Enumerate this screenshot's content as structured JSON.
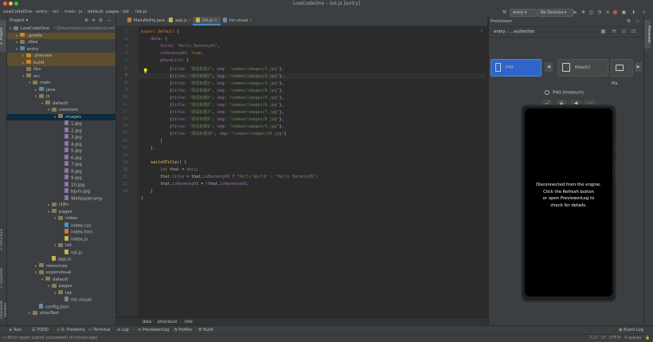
{
  "window": {
    "title": "LowCodeOne – list.js [entry]"
  },
  "nav": {
    "breadcrumb": [
      "LowCodeOne",
      "entry",
      "src",
      "main",
      "js",
      "default",
      "pages",
      "list",
      "list.js"
    ],
    "run_config": "entry",
    "device": "No Devices"
  },
  "project": {
    "header": "Project",
    "rows": [
      {
        "indent": 0,
        "arrow": "▾",
        "icon": "folder-blue",
        "label": "LowCodeOne",
        "hint": "~/Downloads/codelabs/LowC",
        "state": ""
      },
      {
        "indent": 1,
        "arrow": "▸",
        "icon": "folder-orange",
        "label": ".gradle",
        "hint": "",
        "state": "hl"
      },
      {
        "indent": 1,
        "arrow": "▸",
        "icon": "folder",
        "label": ".idea",
        "hint": "",
        "state": ""
      },
      {
        "indent": 1,
        "arrow": "▾",
        "icon": "folder-blue",
        "label": "entry",
        "hint": "",
        "state": ""
      },
      {
        "indent": 2,
        "arrow": "▸",
        "icon": "folder-orange",
        "label": ".preview",
        "hint": "",
        "state": "hl"
      },
      {
        "indent": 2,
        "arrow": "▸",
        "icon": "folder-orange",
        "label": "build",
        "hint": "",
        "state": "hl"
      },
      {
        "indent": 2,
        "arrow": "",
        "icon": "folder",
        "label": "libs",
        "hint": "",
        "state": ""
      },
      {
        "indent": 2,
        "arrow": "▾",
        "icon": "folder",
        "label": "src",
        "hint": "",
        "state": ""
      },
      {
        "indent": 3,
        "arrow": "▾",
        "icon": "folder",
        "label": "main",
        "hint": "",
        "state": ""
      },
      {
        "indent": 4,
        "arrow": "▸",
        "icon": "folder-blue",
        "label": "java",
        "hint": "",
        "state": ""
      },
      {
        "indent": 4,
        "arrow": "▾",
        "icon": "folder",
        "label": "js",
        "hint": "",
        "state": ""
      },
      {
        "indent": 5,
        "arrow": "▾",
        "icon": "folder",
        "label": "default",
        "hint": "",
        "state": ""
      },
      {
        "indent": 6,
        "arrow": "▾",
        "icon": "folder",
        "label": "common",
        "hint": "",
        "state": ""
      },
      {
        "indent": 7,
        "arrow": "▾",
        "icon": "folder",
        "label": "images",
        "hint": "",
        "state": "sel"
      },
      {
        "indent": 8,
        "arrow": "",
        "icon": "file-img",
        "label": "1.jpg",
        "hint": "",
        "state": ""
      },
      {
        "indent": 8,
        "arrow": "",
        "icon": "file-img",
        "label": "2.jpg",
        "hint": "",
        "state": ""
      },
      {
        "indent": 8,
        "arrow": "",
        "icon": "file-img",
        "label": "3.jpg",
        "hint": "",
        "state": ""
      },
      {
        "indent": 8,
        "arrow": "",
        "icon": "file-img",
        "label": "4.jpg",
        "hint": "",
        "state": ""
      },
      {
        "indent": 8,
        "arrow": "",
        "icon": "file-img",
        "label": "5.jpg",
        "hint": "",
        "state": ""
      },
      {
        "indent": 8,
        "arrow": "",
        "icon": "file-img",
        "label": "6.jpg",
        "hint": "",
        "state": ""
      },
      {
        "indent": 8,
        "arrow": "",
        "icon": "file-img",
        "label": "7.jpg",
        "hint": "",
        "state": ""
      },
      {
        "indent": 8,
        "arrow": "",
        "icon": "file-img",
        "label": "8.jpg",
        "hint": "",
        "state": ""
      },
      {
        "indent": 8,
        "arrow": "",
        "icon": "file-img",
        "label": "9.jpg",
        "hint": "",
        "state": ""
      },
      {
        "indent": 8,
        "arrow": "",
        "icon": "file-img",
        "label": "10.jpg",
        "hint": "",
        "state": ""
      },
      {
        "indent": 8,
        "arrow": "",
        "icon": "file-img",
        "label": "bg-tv.jpg",
        "hint": "",
        "state": ""
      },
      {
        "indent": 8,
        "arrow": "",
        "icon": "file-img",
        "label": "Wallpaper.png",
        "hint": "",
        "state": ""
      },
      {
        "indent": 6,
        "arrow": "▸",
        "icon": "folder",
        "label": "i18n",
        "hint": "",
        "state": ""
      },
      {
        "indent": 6,
        "arrow": "▾",
        "icon": "folder",
        "label": "pages",
        "hint": "",
        "state": ""
      },
      {
        "indent": 7,
        "arrow": "▾",
        "icon": "folder",
        "label": "index",
        "hint": "",
        "state": ""
      },
      {
        "indent": 8,
        "arrow": "",
        "icon": "file-css",
        "label": "index.css",
        "hint": "",
        "state": ""
      },
      {
        "indent": 8,
        "arrow": "",
        "icon": "file-html",
        "label": "index.hml",
        "hint": "",
        "state": ""
      },
      {
        "indent": 8,
        "arrow": "",
        "icon": "file-js",
        "label": "index.js",
        "hint": "",
        "state": ""
      },
      {
        "indent": 7,
        "arrow": "▾",
        "icon": "folder",
        "label": "list",
        "hint": "",
        "state": ""
      },
      {
        "indent": 8,
        "arrow": "",
        "icon": "file-js",
        "label": "list.js",
        "hint": "",
        "state": ""
      },
      {
        "indent": 6,
        "arrow": "",
        "icon": "file-js",
        "label": "app.js",
        "hint": "",
        "state": ""
      },
      {
        "indent": 4,
        "arrow": "▸",
        "icon": "folder",
        "label": "resources",
        "hint": "",
        "state": ""
      },
      {
        "indent": 4,
        "arrow": "▾",
        "icon": "folder",
        "label": "supervisual",
        "hint": "",
        "state": ""
      },
      {
        "indent": 5,
        "arrow": "▾",
        "icon": "folder",
        "label": "default",
        "hint": "",
        "state": ""
      },
      {
        "indent": 6,
        "arrow": "▾",
        "icon": "folder",
        "label": "pages",
        "hint": "",
        "state": ""
      },
      {
        "indent": 7,
        "arrow": "▾",
        "icon": "folder",
        "label": "list",
        "hint": "",
        "state": ""
      },
      {
        "indent": 8,
        "arrow": "",
        "icon": "file",
        "label": "list.visual",
        "hint": "",
        "state": ""
      },
      {
        "indent": 4,
        "arrow": "",
        "icon": "file",
        "label": "config.json",
        "hint": "",
        "state": ""
      },
      {
        "indent": 3,
        "arrow": "▸",
        "icon": "folder",
        "label": "ohosTest",
        "hint": "",
        "state": ""
      }
    ]
  },
  "editor": {
    "tabs": [
      "MainAbility.java",
      "app.js",
      "list.js",
      "list.visual"
    ],
    "active_tab": 2,
    "line_numbers": [
      "1",
      "2",
      "3",
      "4",
      "5",
      "6",
      "7",
      "8",
      "9",
      "10",
      "11",
      "12",
      "13",
      "14",
      "15",
      "16",
      "17",
      "18",
      "19",
      "20",
      "21",
      "22",
      "23"
    ],
    "code": [
      [
        [
          "kw",
          "export default "
        ],
        [
          "",
          "{"
        ]
      ],
      [
        [
          "",
          "    "
        ],
        [
          "prop",
          "data"
        ],
        [
          "",
          ": {"
        ]
      ],
      [
        [
          "",
          "        "
        ],
        [
          "prop",
          "title"
        ],
        [
          "",
          ": "
        ],
        [
          "str",
          "\"Hello HarmonyOS\""
        ],
        [
          "",
          ","
        ]
      ],
      [
        [
          "",
          "        "
        ],
        [
          "prop",
          "isHarmonyOS"
        ],
        [
          "",
          ": "
        ],
        [
          "kw",
          "true"
        ],
        [
          "",
          ","
        ]
      ],
      [
        [
          "",
          "        "
        ],
        [
          "prop",
          "phoneList"
        ],
        [
          "",
          ": ["
        ]
      ],
      [
        [
          "",
          "            {"
        ],
        [
          "prop",
          "title"
        ],
        [
          "",
          ": "
        ],
        [
          "str",
          "\"测试标题1\""
        ],
        [
          "",
          ", "
        ],
        [
          "prop",
          "img"
        ],
        [
          "",
          ": "
        ],
        [
          "str",
          "\"common/images/1.jpg\""
        ],
        [
          "",
          "},"
        ]
      ],
      [
        [
          "",
          "            {"
        ],
        [
          "prop",
          "title"
        ],
        [
          "",
          ": "
        ],
        [
          "str",
          "\"测试标题2\""
        ],
        [
          "",
          ", "
        ],
        [
          "prop",
          "img"
        ],
        [
          "",
          ": "
        ],
        [
          "str",
          "\"common/images/2.jpg\""
        ],
        [
          "",
          "},"
        ]
      ],
      [
        [
          "",
          "            {"
        ],
        [
          "prop",
          "title"
        ],
        [
          "",
          ": "
        ],
        [
          "str",
          "\"测试标题3\""
        ],
        [
          "",
          ", "
        ],
        [
          "prop",
          "img"
        ],
        [
          "",
          ": "
        ],
        [
          "str",
          "\"common/images/3.jpg\""
        ],
        [
          "",
          "},"
        ]
      ],
      [
        [
          "",
          "            {"
        ],
        [
          "prop",
          "title"
        ],
        [
          "",
          ": "
        ],
        [
          "str",
          "\"测试标题4\""
        ],
        [
          "",
          ", "
        ],
        [
          "prop",
          "img"
        ],
        [
          "",
          ": "
        ],
        [
          "str",
          "\"common/images/4.jpg\""
        ],
        [
          "",
          "},"
        ]
      ],
      [
        [
          "",
          "            {"
        ],
        [
          "prop",
          "title"
        ],
        [
          "",
          ": "
        ],
        [
          "str",
          "\"测试标题5\""
        ],
        [
          "",
          ", "
        ],
        [
          "prop",
          "img"
        ],
        [
          "",
          ": "
        ],
        [
          "str",
          "\"common/images/5.jpg\""
        ],
        [
          "",
          "},"
        ]
      ],
      [
        [
          "",
          "            {"
        ],
        [
          "prop",
          "title"
        ],
        [
          "",
          ": "
        ],
        [
          "str",
          "\"测试标题6\""
        ],
        [
          "",
          ", "
        ],
        [
          "prop",
          "img"
        ],
        [
          "",
          ": "
        ],
        [
          "str",
          "\"common/images/6.jpg\""
        ],
        [
          "",
          "},"
        ]
      ],
      [
        [
          "",
          "            {"
        ],
        [
          "prop",
          "title"
        ],
        [
          "",
          ": "
        ],
        [
          "str",
          "\"测试标题7\""
        ],
        [
          "",
          ", "
        ],
        [
          "prop",
          "img"
        ],
        [
          "",
          ": "
        ],
        [
          "str",
          "\"common/images/7.jpg\""
        ],
        [
          "",
          "},"
        ]
      ],
      [
        [
          "",
          "            {"
        ],
        [
          "prop",
          "title"
        ],
        [
          "",
          ": "
        ],
        [
          "str",
          "\"测试标题8\""
        ],
        [
          "",
          ", "
        ],
        [
          "prop",
          "img"
        ],
        [
          "",
          ": "
        ],
        [
          "str",
          "\"common/images/8.jpg\""
        ],
        [
          "",
          "},"
        ]
      ],
      [
        [
          "",
          "            {"
        ],
        [
          "prop",
          "title"
        ],
        [
          "",
          ": "
        ],
        [
          "str",
          "\"测试标题9\""
        ],
        [
          "",
          ", "
        ],
        [
          "prop",
          "img"
        ],
        [
          "",
          ": "
        ],
        [
          "str",
          "\"common/images/9.jpg\""
        ],
        [
          "",
          "},"
        ]
      ],
      [
        [
          "",
          "            {"
        ],
        [
          "prop",
          "title"
        ],
        [
          "",
          ": "
        ],
        [
          "str",
          "\"测试标题10\""
        ],
        [
          "",
          ", "
        ],
        [
          "prop",
          "img"
        ],
        [
          "",
          ": "
        ],
        [
          "str",
          "\"common/images/10.jpg\""
        ],
        [
          "",
          "}"
        ]
      ],
      [
        [
          "",
          "        ]"
        ]
      ],
      [
        [
          "",
          "    },"
        ]
      ],
      [
        [
          "",
          ""
        ]
      ],
      [
        [
          "",
          "    "
        ],
        [
          "fn",
          "switchTitle"
        ],
        [
          "",
          "() {"
        ]
      ],
      [
        [
          "",
          "        "
        ],
        [
          "kw",
          "let "
        ],
        [
          "",
          "that = "
        ],
        [
          "kw",
          "this"
        ],
        [
          "",
          ";"
        ]
      ],
      [
        [
          "",
          "        that."
        ],
        [
          "prop",
          "title"
        ],
        [
          "",
          " = that."
        ],
        [
          "prop",
          "isHarmonyOS"
        ],
        [
          "",
          " ? "
        ],
        [
          "str",
          "\"Hello World\""
        ],
        [
          "",
          " : "
        ],
        [
          "str",
          "\"Hello HarmonyOS\""
        ],
        [
          "",
          ";"
        ]
      ],
      [
        [
          "",
          "        that."
        ],
        [
          "prop",
          "isHarmonyOS"
        ],
        [
          "",
          " = !that."
        ],
        [
          "prop",
          "isHarmonyOS"
        ],
        [
          "",
          ";"
        ]
      ],
      [
        [
          "",
          "    }"
        ]
      ],
      [
        [
          "",
          "}"
        ]
      ]
    ],
    "breadcrumb": [
      "data",
      "phoneList",
      "title"
    ]
  },
  "previewer": {
    "title": "Previewer",
    "path": "entry : ...es/list/list",
    "devices": [
      "P40",
      "MateX2",
      "Ma"
    ],
    "profile": "P40 (medium)",
    "message": [
      "Disconnected from the engine.",
      "Click the Refresh button",
      "or open PreviewerLog to",
      "check for details."
    ]
  },
  "bottom_tabs": [
    "Run",
    "TODO",
    "6: Problems",
    "Terminal",
    "Log",
    "PreviewerLog",
    "Profiler",
    "Build"
  ],
  "event_log": "Event Log",
  "status": {
    "message": "Error report submit succeeded! (4 minute ago)",
    "position": "7:27",
    "line_ending": "LF",
    "encoding": "UTF-8",
    "indent": "4 spaces"
  },
  "left_stripe": [
    "1: Project",
    "2: Structure",
    "2: Favorites",
    "OhosBuild Variants"
  ],
  "right_stripe": [
    "Previewer"
  ]
}
